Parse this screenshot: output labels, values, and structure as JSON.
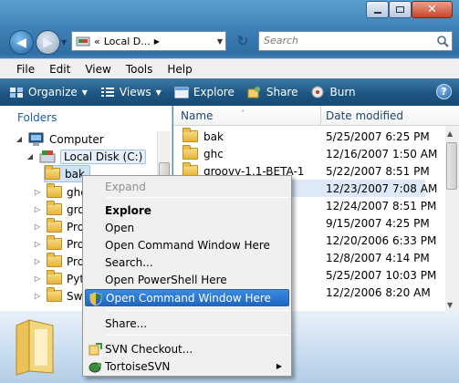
{
  "titlebar": {
    "min_label": "minimize",
    "max_label": "maximize",
    "close_label": "✕"
  },
  "nav": {
    "back_glyph": "◀",
    "forward_glyph": "▶",
    "recent_glyph": "▼",
    "address": {
      "prefix": "«",
      "crumb": "Local D...",
      "crumb_arrow": "▶",
      "dropdown": "▼"
    },
    "refresh_glyph": "↻",
    "search_placeholder": "Search"
  },
  "menubar": {
    "items": [
      "File",
      "Edit",
      "View",
      "Tools",
      "Help"
    ]
  },
  "toolbar": {
    "organize": "Organize",
    "views": "Views",
    "explore": "Explore",
    "share": "Share",
    "burn": "Burn",
    "dd": "▼",
    "help": "?"
  },
  "leftpane": {
    "header": "Folders",
    "computer": "Computer",
    "local_disk": "Local Disk (C:)",
    "items": [
      "bak",
      "ghc",
      "groo",
      "Prog",
      "Prog",
      "Prog",
      "Pyth",
      "SwS"
    ],
    "expand_glyph": "▷",
    "open_glyph": "◢"
  },
  "rightpane": {
    "col_name": "Name",
    "col_date": "Date modified",
    "sort_glyph": "˄",
    "rows": [
      {
        "name": "bak",
        "date": "5/25/2007 6:25 PM"
      },
      {
        "name": "ghc",
        "date": "12/16/2007 1:50 AM"
      },
      {
        "name": "groovy-1.1-BETA-1",
        "date": "5/22/2007 8:51 PM"
      },
      {
        "name": "",
        "date": "12/23/2007 7:08 AM"
      },
      {
        "name": "",
        "date": "12/24/2007 8:51 PM"
      },
      {
        "name": "",
        "date": "9/15/2007 4:25 PM"
      },
      {
        "name": "",
        "date": "12/20/2006 6:33 PM"
      },
      {
        "name": "",
        "date": "12/8/2007 4:14 PM"
      },
      {
        "name": "",
        "date": "5/25/2007 10:03 PM"
      },
      {
        "name": "",
        "date": "12/2/2006 8:20 AM"
      }
    ],
    "scroll_up": "▲",
    "scroll_down": "▼"
  },
  "context_menu": {
    "expand": "Expand",
    "explore": "Explore",
    "open": "Open",
    "open_cmd": "Open Command Window Here",
    "search": "Search...",
    "open_ps": "Open PowerShell Here",
    "open_cmd_admin": "Open Command Window Here",
    "share": "Share...",
    "svn_checkout": "SVN Checkout...",
    "tortoise": "TortoiseSVN",
    "submenu_glyph": "▶"
  },
  "colors": {
    "accent": "#1e66c4",
    "toolbar": "#1e5683",
    "selection": "#dce9f7",
    "folder": "#e6b43a"
  }
}
